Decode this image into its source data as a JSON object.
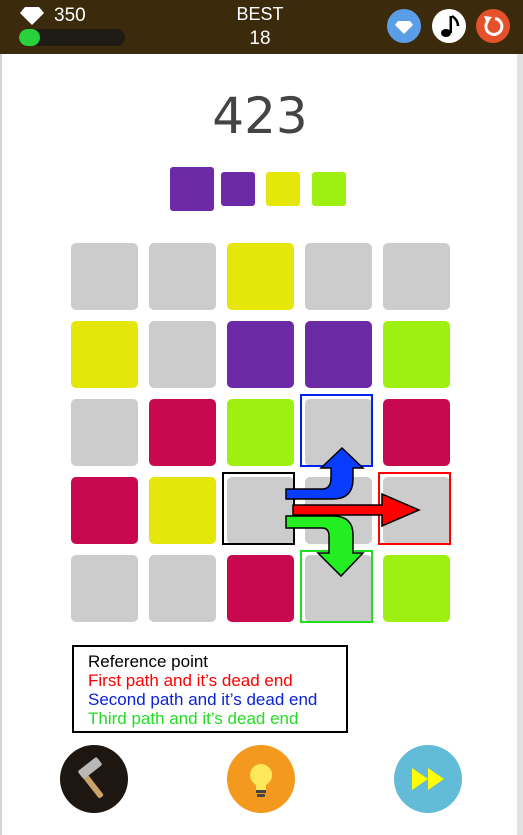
{
  "header": {
    "gems": "350",
    "energy_progress": 0.2,
    "best_label": "BEST",
    "best_value": "18",
    "icons": [
      "gem-icon",
      "diamond-shop-icon",
      "music-note-icon",
      "restart-icon"
    ]
  },
  "game": {
    "score": "423",
    "next_pieces": [
      "purple",
      "purple",
      "yellow",
      "lime"
    ],
    "colors": {
      "gray": "#cccccc",
      "yellow": "#e5e60a",
      "purple": "#6d2aa7",
      "lime": "#9ef011",
      "crimson": "#c8094f"
    },
    "board": [
      [
        "gray",
        "gray",
        "yellow",
        "gray",
        "gray"
      ],
      [
        "yellow",
        "gray",
        "purple",
        "purple",
        "lime"
      ],
      [
        "gray",
        "crimson",
        "lime",
        "gray",
        "crimson"
      ],
      [
        "crimson",
        "yellow",
        "gray",
        "gray",
        "gray"
      ],
      [
        "gray",
        "gray",
        "crimson",
        "gray",
        "lime"
      ]
    ],
    "highlights": [
      {
        "row": 3,
        "col": 2,
        "color": "#000000",
        "meaning": "reference"
      },
      {
        "row": 3,
        "col": 4,
        "color": "#ff0000",
        "meaning": "first-dead-end"
      },
      {
        "row": 2,
        "col": 3,
        "color": "#0022ee",
        "meaning": "second-dead-end"
      },
      {
        "row": 4,
        "col": 3,
        "color": "#22dd22",
        "meaning": "third-dead-end"
      }
    ],
    "arrow_colors": {
      "first": "#ff0000",
      "second": "#0a3cff",
      "third": "#22ee22"
    }
  },
  "legend": {
    "reference": "Reference point",
    "first": "First path and it’s dead end",
    "second": "Second path and it’s dead end",
    "third": "Third path and it’s dead end",
    "colors": {
      "reference": "#000000",
      "first": "#ff0000",
      "second": "#0a22d8",
      "third": "#22dd22"
    }
  },
  "controls": {
    "icons": [
      "hammer-icon",
      "lightbulb-icon",
      "fast-forward-icon"
    ]
  }
}
